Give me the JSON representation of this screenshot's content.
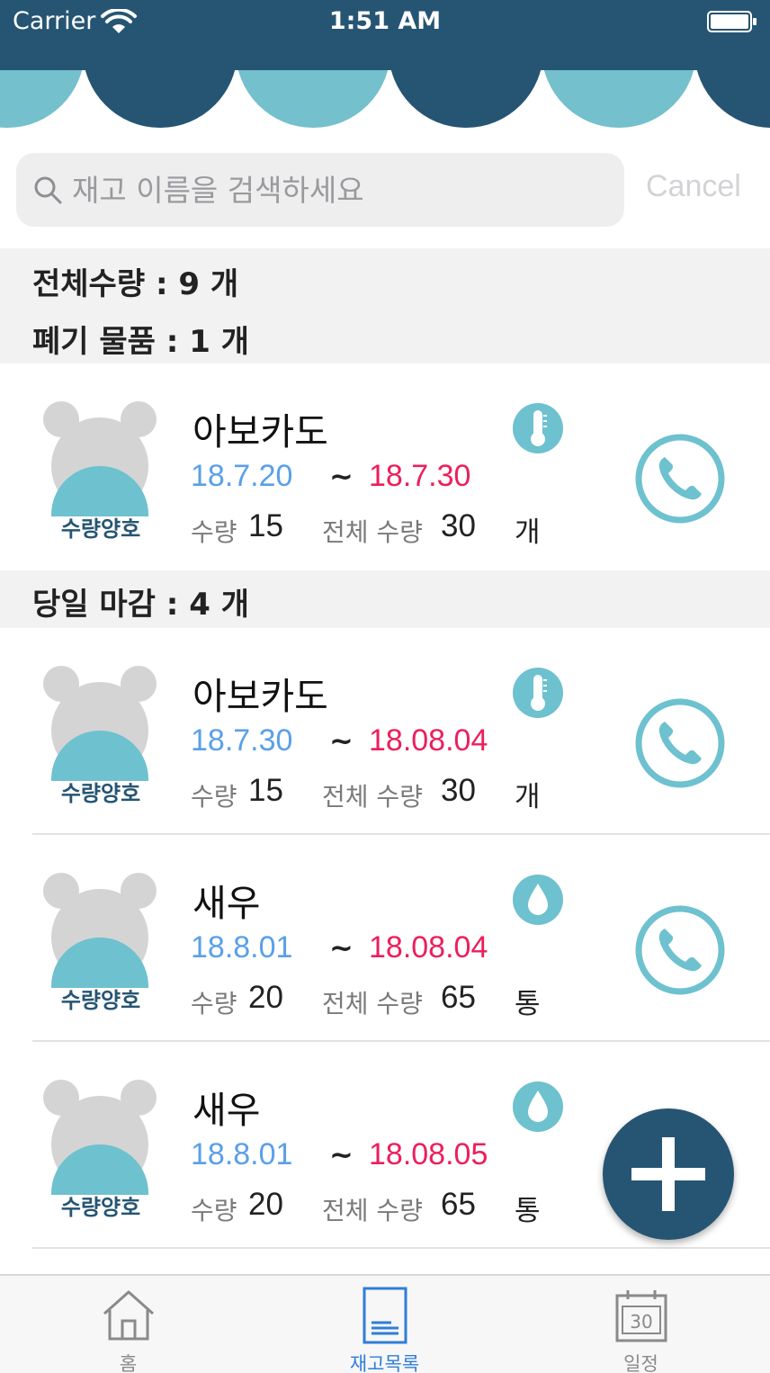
{
  "status_bar": {
    "carrier": "Carrier",
    "time": "1:51 AM"
  },
  "search": {
    "placeholder": "재고 이름을 검색하세요",
    "value": "",
    "cancel_label": "Cancel"
  },
  "summary": {
    "total_qty": "전체수량  : 9 개",
    "disposal": "폐기 물품  : 1 개"
  },
  "today_section": {
    "label": "당일 마감  : 4 개"
  },
  "items": [
    {
      "name": "아보카도",
      "status": "수량양호",
      "storage": "thermometer-icon",
      "start": "18.7.20",
      "tilde": "~",
      "end": "18.7.30",
      "qty_label": "수량",
      "qty": "15",
      "total_label": "전체 수량",
      "total": "30",
      "unit": "개"
    },
    {
      "name": "아보카도",
      "status": "수량양호",
      "storage": "thermometer-icon",
      "start": "18.7.30",
      "tilde": "~",
      "end": "18.08.04",
      "qty_label": "수량",
      "qty": "15",
      "total_label": "전체 수량",
      "total": "30",
      "unit": "개"
    },
    {
      "name": "새우",
      "status": "수량양호",
      "storage": "water-drop-icon",
      "start": "18.8.01",
      "tilde": "~",
      "end": "18.08.04",
      "qty_label": "수량",
      "qty": "20",
      "total_label": "전체 수량",
      "total": "65",
      "unit": "통"
    },
    {
      "name": "새우",
      "status": "수량양호",
      "storage": "water-drop-icon",
      "start": "18.8.01",
      "tilde": "~",
      "end": "18.08.05",
      "qty_label": "수량",
      "qty": "20",
      "total_label": "전체 수량",
      "total": "65",
      "unit": "통"
    }
  ],
  "tabs": [
    {
      "label": "홈",
      "icon": "home-icon",
      "active": false
    },
    {
      "label": "재고목록",
      "icon": "document-icon",
      "active": true
    },
    {
      "label": "일정",
      "icon": "calendar-icon",
      "active": false,
      "calendar_day": "30"
    }
  ],
  "colors": {
    "header": "#265573",
    "wave_light": "#74c0cc",
    "accent_teal": "#6ec1cf",
    "date_start": "#5aa0e8",
    "date_end": "#ec1f5c",
    "tab_active": "#2f7ed8"
  }
}
